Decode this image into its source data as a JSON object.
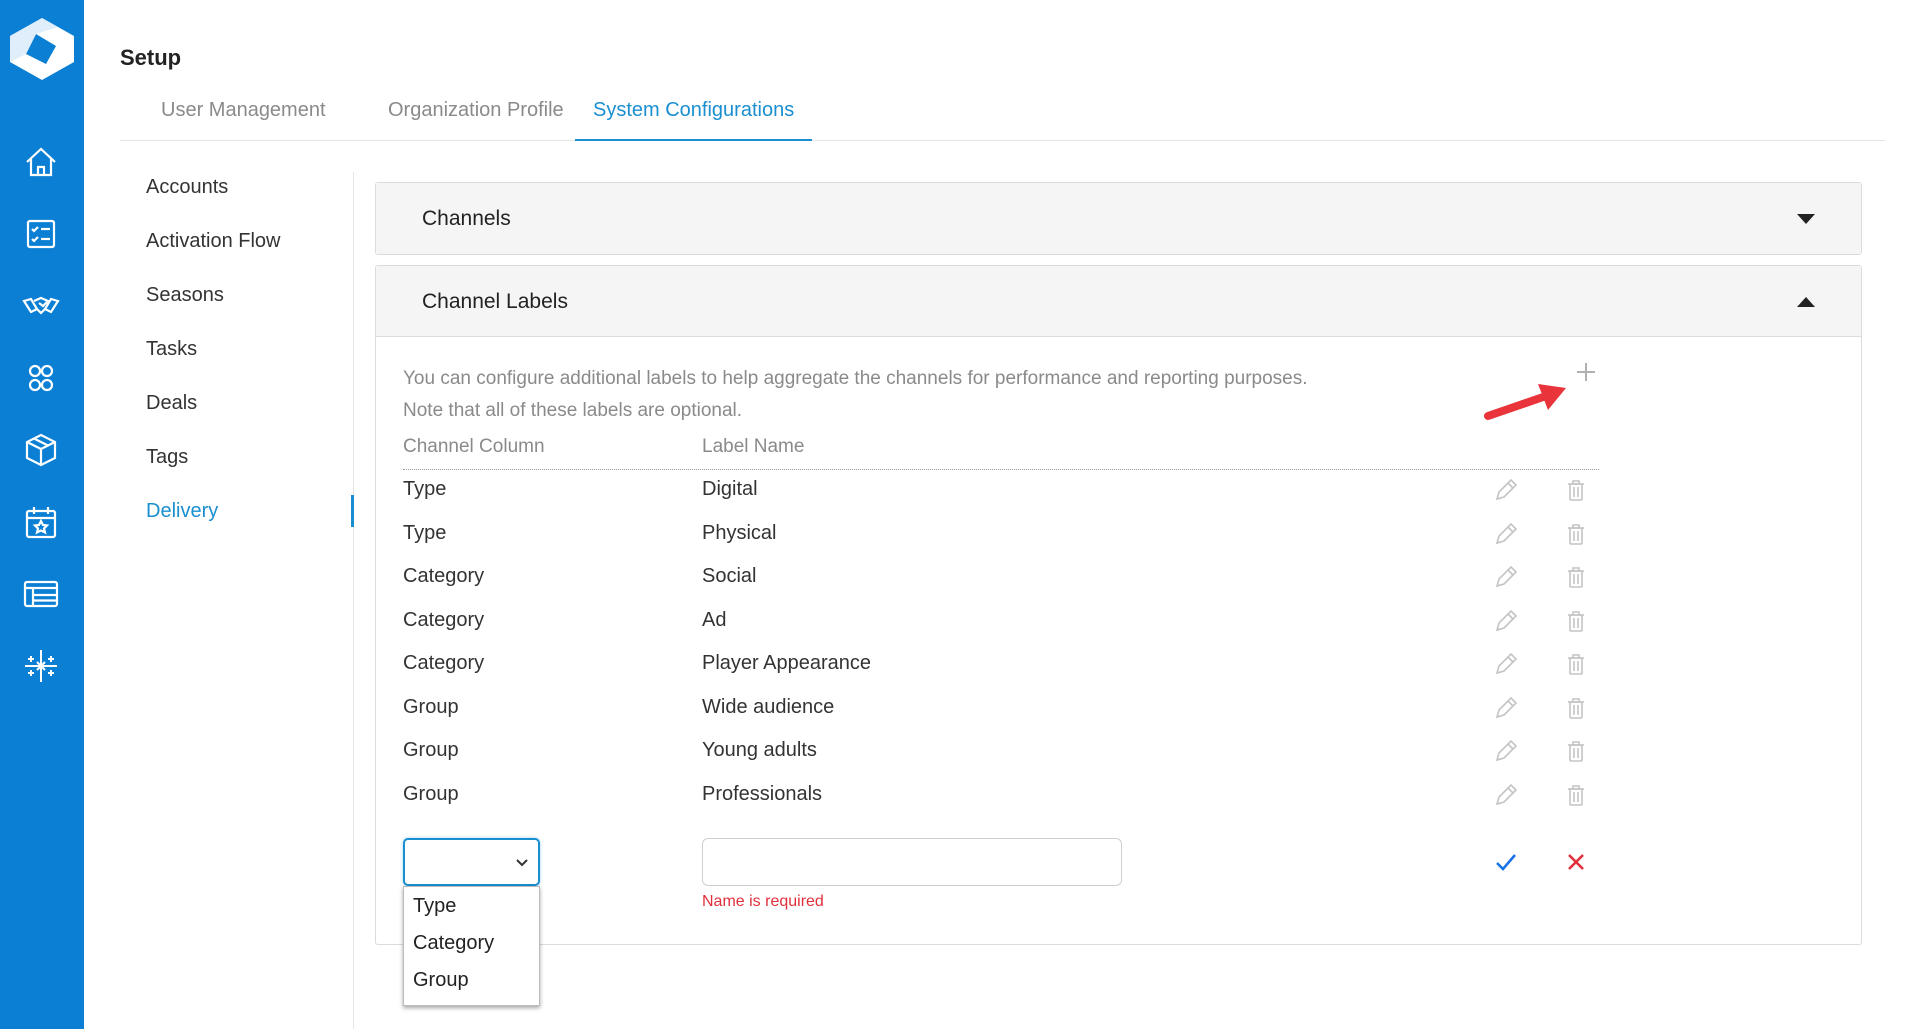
{
  "colors": {
    "rail": "#0b7fd4",
    "accent": "#1a8fd0",
    "error": "#e0303b",
    "annotation_arrow": "#e8343a"
  },
  "rail": {
    "logo": "app-logo",
    "icons": [
      "home-icon",
      "checklist-icon",
      "handshake-icon",
      "contacts-group-icon",
      "cube-icon",
      "calendar-star-icon",
      "table-list-icon",
      "sparkle-grid-icon"
    ]
  },
  "header": {
    "title": "Setup",
    "tabs": [
      {
        "label": "User Management"
      },
      {
        "label": "Organization Profile"
      },
      {
        "label": "System Configurations",
        "active": true
      }
    ]
  },
  "subnav": {
    "items": [
      {
        "label": "Accounts"
      },
      {
        "label": "Activation Flow"
      },
      {
        "label": "Seasons"
      },
      {
        "label": "Tasks"
      },
      {
        "label": "Deals"
      },
      {
        "label": "Tags"
      },
      {
        "label": "Delivery",
        "active": true
      }
    ]
  },
  "panels": {
    "channels": {
      "title": "Channels",
      "expanded": false
    },
    "channel_labels": {
      "title": "Channel Labels",
      "expanded": true,
      "desc_line1": "You can configure additional labels to help aggregate the channels for performance and reporting purposes.",
      "desc_line2": "Note that all of these labels are optional.",
      "add_icon": "plus-icon",
      "col_channel_column": "Channel Column",
      "col_label_name": "Label Name",
      "rows": [
        {
          "column": "Type",
          "label": "Digital"
        },
        {
          "column": "Type",
          "label": "Physical"
        },
        {
          "column": "Category",
          "label": "Social"
        },
        {
          "column": "Category",
          "label": "Ad"
        },
        {
          "column": "Category",
          "label": "Player Appearance"
        },
        {
          "column": "Group",
          "label": "Wide audience"
        },
        {
          "column": "Group",
          "label": "Young adults"
        },
        {
          "column": "Group",
          "label": "Professionals"
        }
      ],
      "row_icons": {
        "edit": "pencil-icon",
        "delete": "trash-icon"
      },
      "new_row": {
        "select_value": "",
        "options": [
          "Type",
          "Category",
          "Group"
        ],
        "name_value": "",
        "error": "Name is required",
        "confirm_icon": "check-icon",
        "cancel_icon": "close-icon"
      }
    }
  }
}
